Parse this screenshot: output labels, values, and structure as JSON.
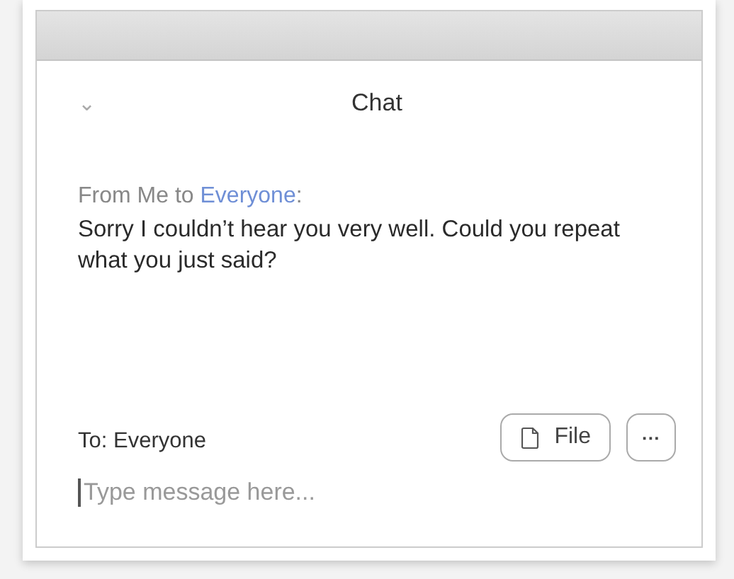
{
  "panel": {
    "title": "Chat",
    "collapse_icon": "⌄"
  },
  "messages": [
    {
      "from_label": "From Me to",
      "recipient": "Everyone",
      "separator": ":",
      "text": "Sorry I couldn’t hear you very well. Could you repeat what you just said?"
    }
  ],
  "composer": {
    "to_label": "To: Everyone",
    "buttons": [
      {
        "kind": "file",
        "label": "File"
      },
      {
        "kind": "more",
        "label": "···"
      }
    ],
    "input": {
      "placeholder": "Type message here..."
    }
  }
}
